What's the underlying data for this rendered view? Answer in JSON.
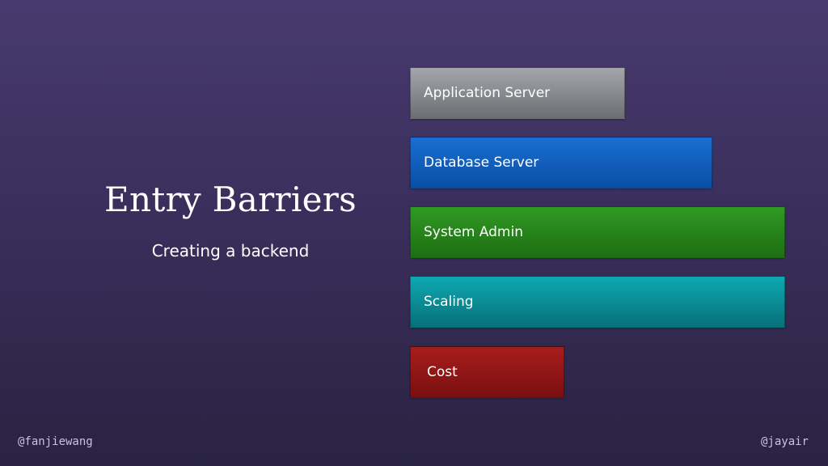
{
  "slide": {
    "title": "Entry Barriers",
    "subtitle": "Creating a backend"
  },
  "bars": [
    {
      "label": "Application Server",
      "color": "#8a8d91"
    },
    {
      "label": "Database Server",
      "color": "#0b5cc0"
    },
    {
      "label": "System Admin",
      "color": "#238418"
    },
    {
      "label": "Scaling",
      "color": "#0a8d96"
    },
    {
      "label": "Cost",
      "color": "#8f1616"
    }
  ],
  "footer": {
    "left_handle": "@fanjiewang",
    "right_handle": "@jayair"
  }
}
